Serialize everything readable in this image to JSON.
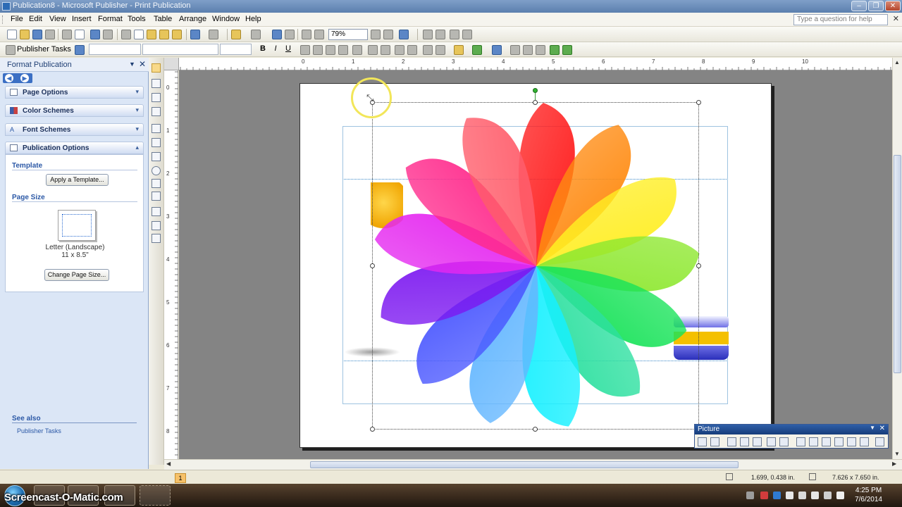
{
  "window": {
    "title": "Publication8 - Microsoft Publisher - Print Publication"
  },
  "menu": {
    "items": [
      "File",
      "Edit",
      "View",
      "Insert",
      "Format",
      "Tools",
      "Table",
      "Arrange",
      "Window",
      "Help"
    ],
    "ask_placeholder": "Type a question for help"
  },
  "toolbar": {
    "zoom": "79%",
    "publisher_tasks": "Publisher Tasks",
    "bold": "B",
    "italic": "I",
    "underline": "U"
  },
  "taskpane": {
    "title": "Format Publication",
    "sections": [
      "Page Options",
      "Color Schemes",
      "Font Schemes",
      "Publication Options"
    ],
    "template_heading": "Template",
    "apply_template_button": "Apply a Template...",
    "page_size_heading": "Page Size",
    "page_size_name": "Letter (Landscape)",
    "page_size_dims": "11 x 8.5\"",
    "change_page_size_button": "Change Page Size...",
    "see_also_heading": "See also",
    "see_also_link": "Publisher Tasks"
  },
  "rulers": {
    "h_labels": [
      "0",
      "1",
      "2",
      "3",
      "4",
      "5",
      "6",
      "7",
      "8",
      "9",
      "10"
    ],
    "v_labels": [
      "0",
      "1",
      "2",
      "3",
      "4",
      "5",
      "6",
      "7",
      "8"
    ]
  },
  "picture_toolbar": {
    "title": "Picture"
  },
  "status": {
    "page_number": "1",
    "position": "1.699, 0.438 in.",
    "size": "7.626 x 7.650 in."
  },
  "taskbar": {
    "time": "4:25 PM",
    "date": "7/6/2014",
    "watermark": "Screencast-O-Matic.com"
  },
  "colors": {
    "petals": [
      "#ff1b1b",
      "#ff8a10",
      "#ffee22",
      "#8ee830",
      "#19e35a",
      "#2de0a0",
      "#16f0ff",
      "#64b7ff",
      "#4a57ff",
      "#7c18f0",
      "#e528f0",
      "#ff2a8c",
      "#ff5c6a"
    ],
    "title_bar": "#5b7fae",
    "task_pane": "#dbe6f6",
    "link": "#2b58a6"
  }
}
